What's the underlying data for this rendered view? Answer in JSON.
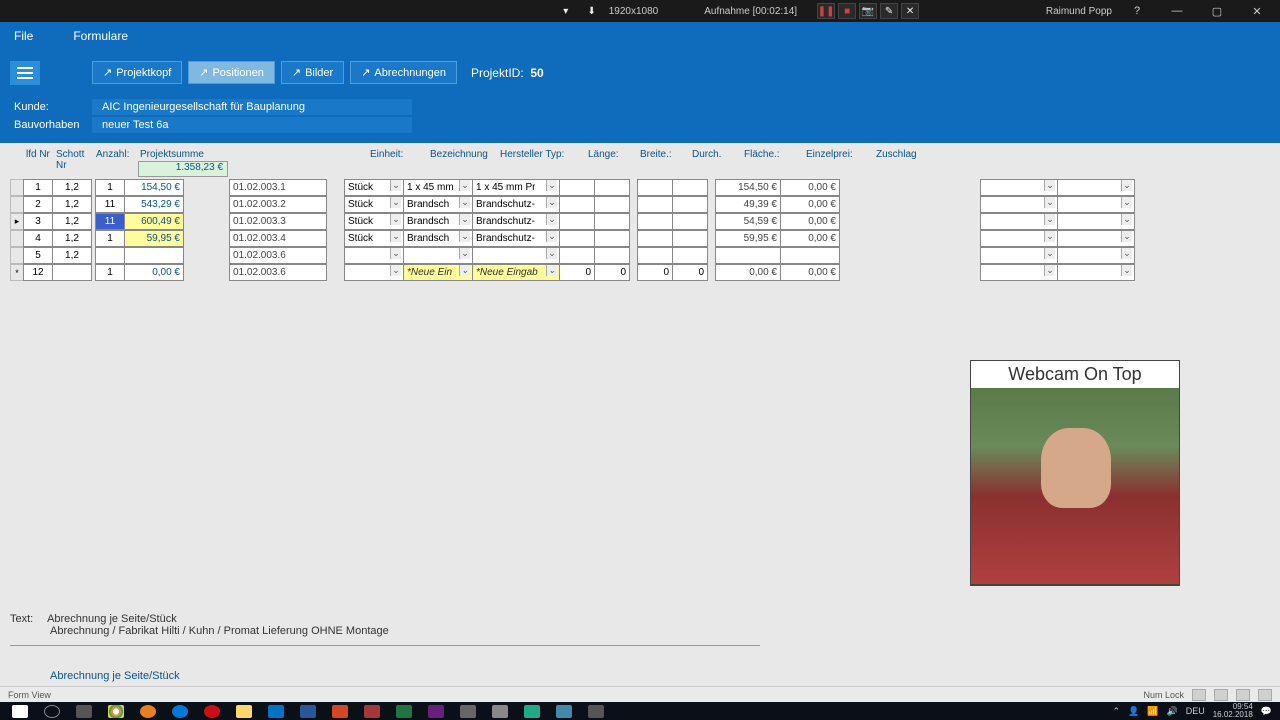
{
  "titlebar": {
    "resolution": "1920x1080",
    "recording": "Aufnahme [00:02:14]",
    "user": "Raimund Popp"
  },
  "menubar": {
    "file": "File",
    "formulare": "Formulare"
  },
  "tabs": {
    "projektkopf": "Projektkopf",
    "positionen": "Positionen",
    "bilder": "Bilder",
    "abrechnungen": "Abrechnungen"
  },
  "project": {
    "id_label": "ProjektID:",
    "id": "50"
  },
  "info": {
    "kunde_lbl": "Kunde:",
    "kunde": "AIC Ingenieurgesellschaft für Bauplanung",
    "bv_lbl": "Bauvorhaben",
    "bv": "neuer Test 6a"
  },
  "headers": {
    "lfd": "lfd Nr",
    "schott": "Schott Nr",
    "anzahl": "Anzahl:",
    "psumme": "Projektsumme",
    "psum_val": "1.358,23 €",
    "einheit": "Einheit:",
    "bez": "Bezeichnung",
    "herst": "Hersteller Typ:",
    "laenge": "Länge:",
    "breite": "Breite.:",
    "durch": "Durch.",
    "flaeche": "Fläche.:",
    "ep": "Einzelprei:",
    "zu": "Zuschlag"
  },
  "rows": [
    {
      "lfd": "1",
      "schott": "1,2",
      "anz": "1",
      "sum": "154,50 €",
      "code": "01.02.003.1",
      "einh": "Stück",
      "bez": "1 x 45 mm",
      "herst": "1 x 45 mm Pr",
      "ep": "154,50 €",
      "zu": "0,00 €"
    },
    {
      "lfd": "2",
      "schott": "1,2",
      "anz": "11",
      "sum": "543,29 €",
      "code": "01.02.003.2",
      "einh": "Stück",
      "bez": "Brandsch",
      "herst": "Brandschutz-",
      "ep": "49,39 €",
      "zu": "0,00 €"
    },
    {
      "lfd": "3",
      "schott": "1,2",
      "anz": "11",
      "sum": "600,49 €",
      "code": "01.02.003.3",
      "einh": "Stück",
      "bez": "Brandsch",
      "herst": "Brandschutz-",
      "ep": "54,59 €",
      "zu": "0,00 €"
    },
    {
      "lfd": "4",
      "schott": "1,2",
      "anz": "1",
      "sum": "59,95 €",
      "code": "01.02.003.4",
      "einh": "Stück",
      "bez": "Brandsch",
      "herst": "Brandschutz-",
      "ep": "59,95 €",
      "zu": "0,00 €"
    },
    {
      "lfd": "5",
      "schott": "1,2",
      "anz": "",
      "sum": "",
      "code": "01.02.003.6",
      "einh": "",
      "bez": "",
      "herst": "",
      "ep": "",
      "zu": ""
    },
    {
      "lfd": "12",
      "schott": "",
      "anz": "1",
      "sum": "0,00 €",
      "code": "01.02.003.6",
      "einh": "",
      "bez": "*Neue Ein",
      "herst": "*Neue Eingab",
      "d1": "0",
      "d2": "0",
      "d3": "0",
      "d4": "0",
      "ep": "0,00 €",
      "zu": "0,00 €"
    }
  ],
  "bottom": {
    "text_lbl": "Text:",
    "line1": "Abrechnung je Seite/Stück",
    "line2": "Abrechnung / Fabrikat Hilti / Kuhn / Promat Lieferung OHNE Montage",
    "link": "Abrechnung je Seite/Stück"
  },
  "statusbar": {
    "left": "Form View",
    "numlock": "Num Lock"
  },
  "tray": {
    "lang": "DEU",
    "time": "09:54",
    "date": "16.02.2018"
  },
  "webcam": {
    "title": "Webcam On Top"
  }
}
